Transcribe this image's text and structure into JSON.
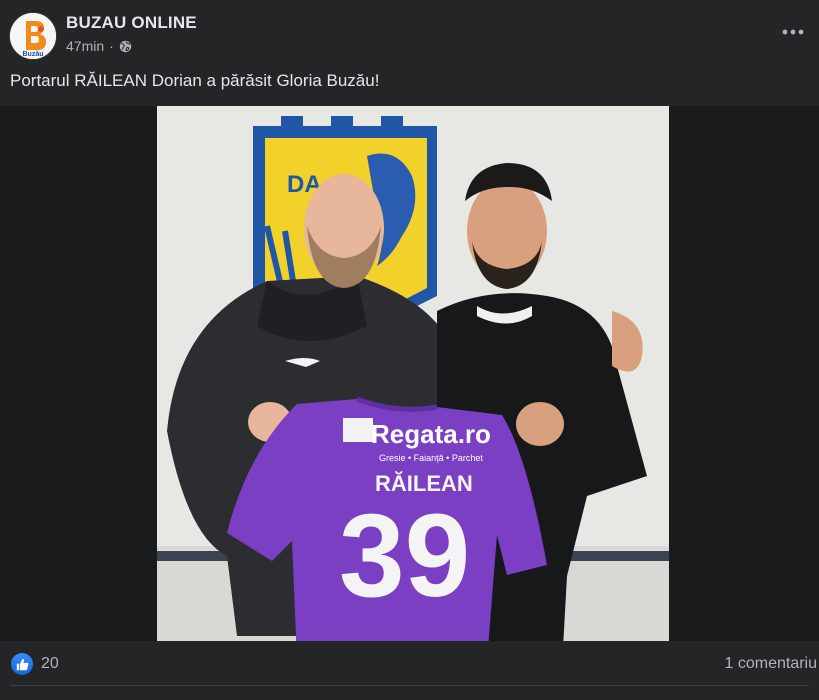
{
  "post": {
    "page_name": "BUZAU ONLINE",
    "avatar_text": "Buzău",
    "time": "47min",
    "separator": "·",
    "audience_icon": "globe-icon",
    "more_icon": "more-horizontal-icon",
    "caption": "Portarul RĂILEAN Dorian a părăsit Gloria Buzău!"
  },
  "photo": {
    "jersey_sponsor": "Regata.ro",
    "jersey_sponsor_sub": "Gresie • Faianță • Parchet",
    "jersey_name": "RĂILEAN",
    "jersey_number": "39",
    "crest_text": "DA"
  },
  "footer": {
    "like_icon": "like-thumb-icon",
    "reaction_count": "20",
    "comments": "1 comentariu"
  },
  "colors": {
    "background": "#242526",
    "media_background": "#1a1b1c",
    "text_primary": "#e4e6eb",
    "text_secondary": "#b0b3b8",
    "like_blue": "#1877f2",
    "jersey_purple": "#7b3fc4"
  }
}
